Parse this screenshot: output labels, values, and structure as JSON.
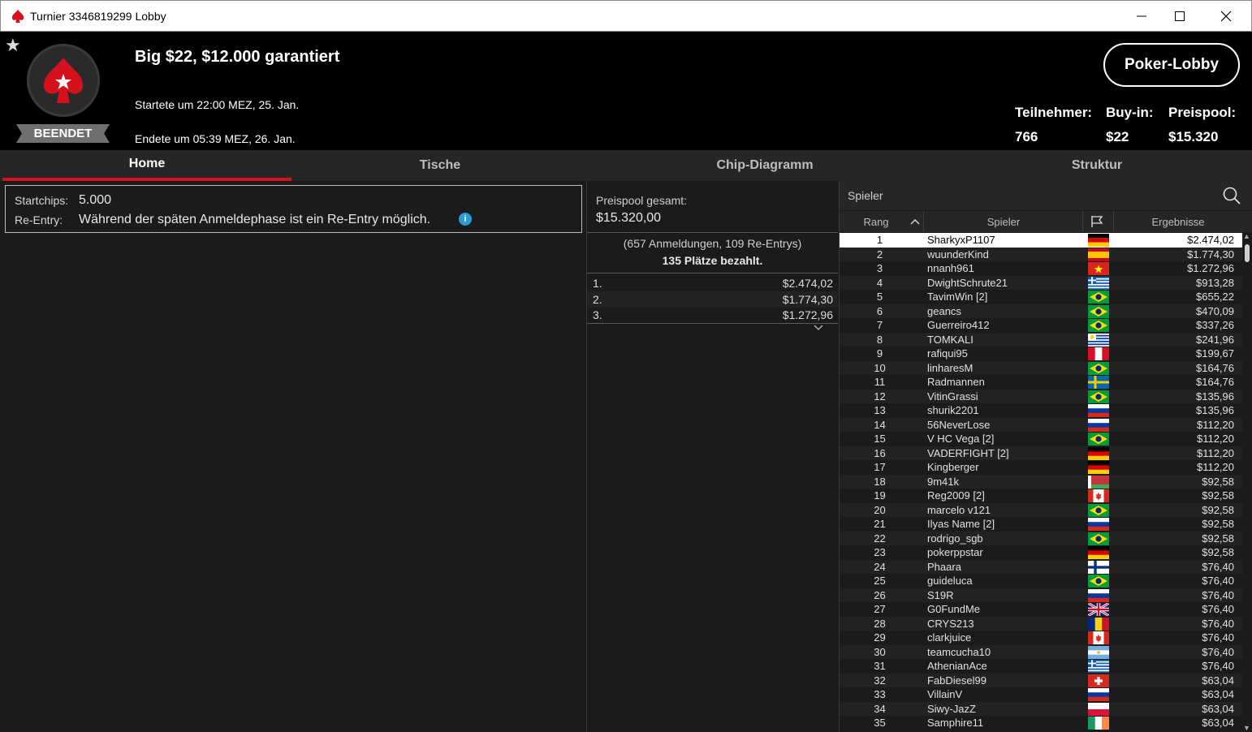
{
  "window": {
    "title": "Turnier 3346819299 Lobby",
    "minimize": "—",
    "maximize": "☐",
    "close": "✕"
  },
  "header": {
    "tournament_name": "Big $22, $12.000 garantiert",
    "started": "Startete um 22:00 MEZ, 25. Jan.",
    "ended": "Endete um 05:39 MEZ, 26. Jan.",
    "status": "BEENDET",
    "lobby_button": "Poker-Lobby",
    "stats": [
      {
        "label": "Teilnehmer:",
        "value": "766"
      },
      {
        "label": "Buy-in:",
        "value": "$22"
      },
      {
        "label": "Preispool:",
        "value": "$15.320"
      }
    ]
  },
  "tabs": [
    "Home",
    "Tische",
    "Chip-Diagramm",
    "Struktur"
  ],
  "info": {
    "startchips_label": "Startchips:",
    "startchips_value": "5.000",
    "reentry_label": "Re-Entry:",
    "reentry_value": "Während der späten Anmeldephase ist ein Re-Entry möglich."
  },
  "prizepool": {
    "total_label": "Preispool gesamt:",
    "total_value": "$15.320,00",
    "registrations": "(657 Anmeldungen, 109 Re-Entrys)",
    "paid": "135 Plätze bezahlt.",
    "places": [
      {
        "pos": "1.",
        "amount": "$2.474,02"
      },
      {
        "pos": "2.",
        "amount": "$1.774,30"
      },
      {
        "pos": "3.",
        "amount": "$1.272,96"
      }
    ]
  },
  "players": {
    "search_placeholder": "Spieler",
    "headers": {
      "rank": "Rang",
      "player": "Spieler",
      "result": "Ergebnisse"
    },
    "rows": [
      {
        "rank": "1",
        "name": "SharkyxP1107",
        "flag": "de",
        "result": "$2.474,02"
      },
      {
        "rank": "2",
        "name": "wuunderKind",
        "flag": "es",
        "result": "$1.774,30"
      },
      {
        "rank": "3",
        "name": "nnanh961",
        "flag": "vn",
        "result": "$1.272,96"
      },
      {
        "rank": "4",
        "name": "DwightSchrute21",
        "flag": "gr",
        "result": "$913,28"
      },
      {
        "rank": "5",
        "name": "TavimWin [2]",
        "flag": "br",
        "result": "$655,22"
      },
      {
        "rank": "6",
        "name": "geancs",
        "flag": "br",
        "result": "$470,09"
      },
      {
        "rank": "7",
        "name": "Guerreiro412",
        "flag": "br",
        "result": "$337,26"
      },
      {
        "rank": "8",
        "name": "TOMKALI",
        "flag": "uy",
        "result": "$241,96"
      },
      {
        "rank": "9",
        "name": "rafiqui95",
        "flag": "pe",
        "result": "$199,67"
      },
      {
        "rank": "10",
        "name": "linharesM",
        "flag": "br",
        "result": "$164,76"
      },
      {
        "rank": "11",
        "name": "Radmannen",
        "flag": "se",
        "result": "$164,76"
      },
      {
        "rank": "12",
        "name": "VitinGrassi",
        "flag": "br",
        "result": "$135,96"
      },
      {
        "rank": "13",
        "name": "shurik2201",
        "flag": "ru",
        "result": "$135,96"
      },
      {
        "rank": "14",
        "name": "56NeverLose",
        "flag": "ru",
        "result": "$112,20"
      },
      {
        "rank": "15",
        "name": "V HC Vega [2]",
        "flag": "br",
        "result": "$112,20"
      },
      {
        "rank": "16",
        "name": "VADERFIGHT [2]",
        "flag": "de",
        "result": "$112,20"
      },
      {
        "rank": "17",
        "name": "Kingberger",
        "flag": "de",
        "result": "$112,20"
      },
      {
        "rank": "18",
        "name": "9m41k",
        "flag": "by",
        "result": "$92,58"
      },
      {
        "rank": "19",
        "name": "Reg2009 [2]",
        "flag": "ca",
        "result": "$92,58"
      },
      {
        "rank": "20",
        "name": "marcelo v121",
        "flag": "br",
        "result": "$92,58"
      },
      {
        "rank": "21",
        "name": "Ilyas Name [2]",
        "flag": "ru",
        "result": "$92,58"
      },
      {
        "rank": "22",
        "name": "rodrigo_sgb",
        "flag": "br",
        "result": "$92,58"
      },
      {
        "rank": "23",
        "name": "pokerppstar",
        "flag": "de",
        "result": "$92,58"
      },
      {
        "rank": "24",
        "name": "Phaara",
        "flag": "fi",
        "result": "$76,40"
      },
      {
        "rank": "25",
        "name": "guideluca",
        "flag": "br",
        "result": "$76,40"
      },
      {
        "rank": "26",
        "name": "S19R",
        "flag": "ru",
        "result": "$76,40"
      },
      {
        "rank": "27",
        "name": "G0FundMe",
        "flag": "gb",
        "result": "$76,40"
      },
      {
        "rank": "28",
        "name": "CRYS213",
        "flag": "ro",
        "result": "$76,40"
      },
      {
        "rank": "29",
        "name": "clarkjuice",
        "flag": "ca",
        "result": "$76,40"
      },
      {
        "rank": "30",
        "name": "teamcucha10",
        "flag": "ar",
        "result": "$76,40"
      },
      {
        "rank": "31",
        "name": "AthenianAce",
        "flag": "gr",
        "result": "$76,40"
      },
      {
        "rank": "32",
        "name": "FabDiesel99",
        "flag": "ch",
        "result": "$63,04"
      },
      {
        "rank": "33",
        "name": "VillainV",
        "flag": "ru",
        "result": "$63,04"
      },
      {
        "rank": "34",
        "name": "Siwy-JazZ",
        "flag": "pl",
        "result": "$63,04"
      },
      {
        "rank": "35",
        "name": "Samphire11",
        "flag": "ie",
        "result": "$63,04"
      }
    ]
  },
  "colors": {
    "accent": "#d4121e",
    "background": "#1b1b1b",
    "header": "#000000"
  }
}
